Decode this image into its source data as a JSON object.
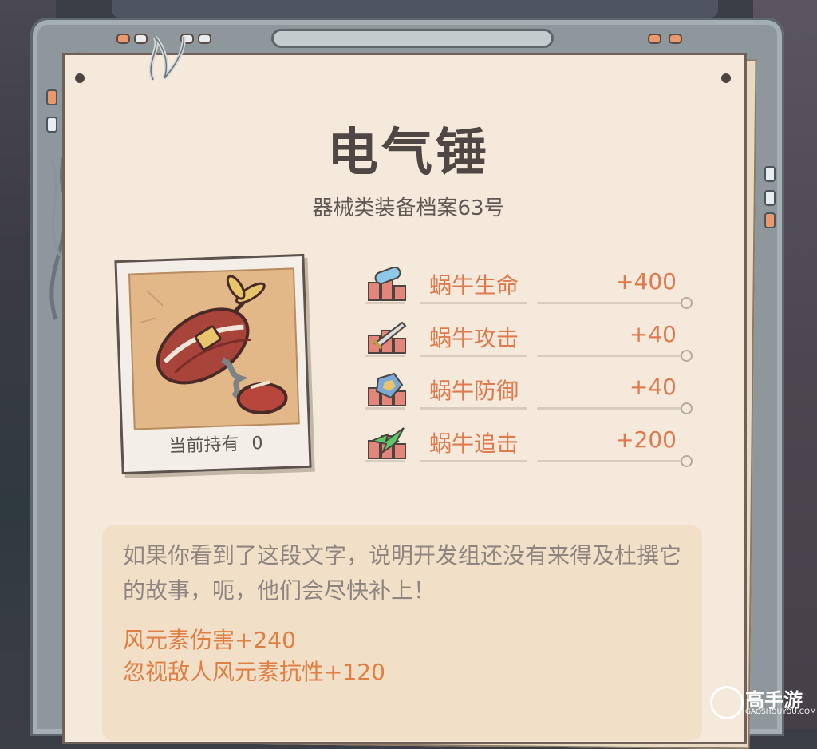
{
  "item": {
    "title": "电气锤",
    "subtitle": "器械类装备档案63号",
    "owned_label": "当前持有",
    "owned_count": "0"
  },
  "stats": [
    {
      "label": "蜗牛生命",
      "value": "+400",
      "icon": "capsule-icon",
      "color": "#8cc8e8"
    },
    {
      "label": "蜗牛攻击",
      "value": "+40",
      "icon": "sword-icon",
      "color": "#c9c9c9"
    },
    {
      "label": "蜗牛防御",
      "value": "+40",
      "icon": "shield-icon",
      "color": "#7aa8d8"
    },
    {
      "label": "蜗牛追击",
      "value": "+200",
      "icon": "lightning-icon",
      "color": "#5fc66a"
    }
  ],
  "description": "如果你看到了这段文字，说明开发组还没有来得及杜撰它的故事，呃，他们会尽快补上！",
  "effects": [
    "风元素伤害+240",
    "忽视敌人风元素抗性+120"
  ],
  "watermark": {
    "name": "高手游",
    "domain": "GAOSHOUYOU.COM"
  },
  "colors": {
    "accent": "#de7a4e",
    "paper": "#f4e9da",
    "text": "#4e4743"
  }
}
